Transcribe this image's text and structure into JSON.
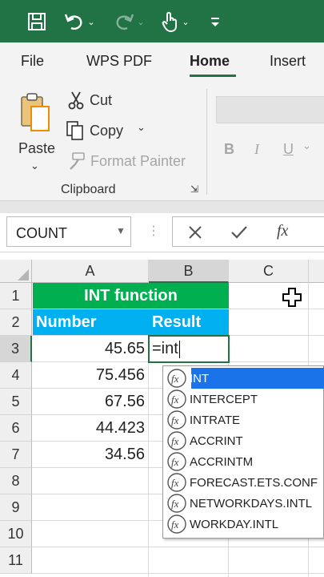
{
  "quick_access": {
    "save_icon": "save-icon",
    "undo_icon": "undo-icon",
    "redo_icon": "redo-icon",
    "touch_icon": "touch-mode-icon",
    "customize_icon": "customize-qat-icon"
  },
  "tabs": [
    {
      "label": "File"
    },
    {
      "label": "WPS PDF"
    },
    {
      "label": "Home"
    },
    {
      "label": "Insert"
    }
  ],
  "ribbon": {
    "paste_label": "Paste",
    "cut_label": "Cut",
    "copy_label": "Copy",
    "format_painter_label": "Format Painter",
    "group_label": "Clipboard",
    "bold": "B",
    "italic": "I",
    "underline": "U"
  },
  "formula_bar": {
    "name_box": "COUNT",
    "fx": "fx"
  },
  "columns": [
    "A",
    "B",
    "C"
  ],
  "rows": [
    "1",
    "2",
    "3",
    "4",
    "5",
    "6",
    "7",
    "8",
    "9",
    "10",
    "11"
  ],
  "sheet": {
    "title": "INT function",
    "header_number": "Number",
    "header_result": "Result",
    "values": [
      "45.65",
      "75.456",
      "67.56",
      "44.423",
      "34.56"
    ],
    "editing_text": "=int"
  },
  "autocomplete": [
    {
      "label": "INT"
    },
    {
      "label": "INTERCEPT"
    },
    {
      "label": "INTRATE"
    },
    {
      "label": "ACCRINT"
    },
    {
      "label": "ACCRINTM"
    },
    {
      "label": "FORECAST.ETS.CONF"
    },
    {
      "label": "NETWORKDAYS.INTL"
    },
    {
      "label": "WORKDAY.INTL"
    }
  ],
  "colors": {
    "excel_green": "#217346",
    "title_fill": "#00b050",
    "header_fill": "#00b0f0",
    "selection_blue": "#1a73e8"
  }
}
